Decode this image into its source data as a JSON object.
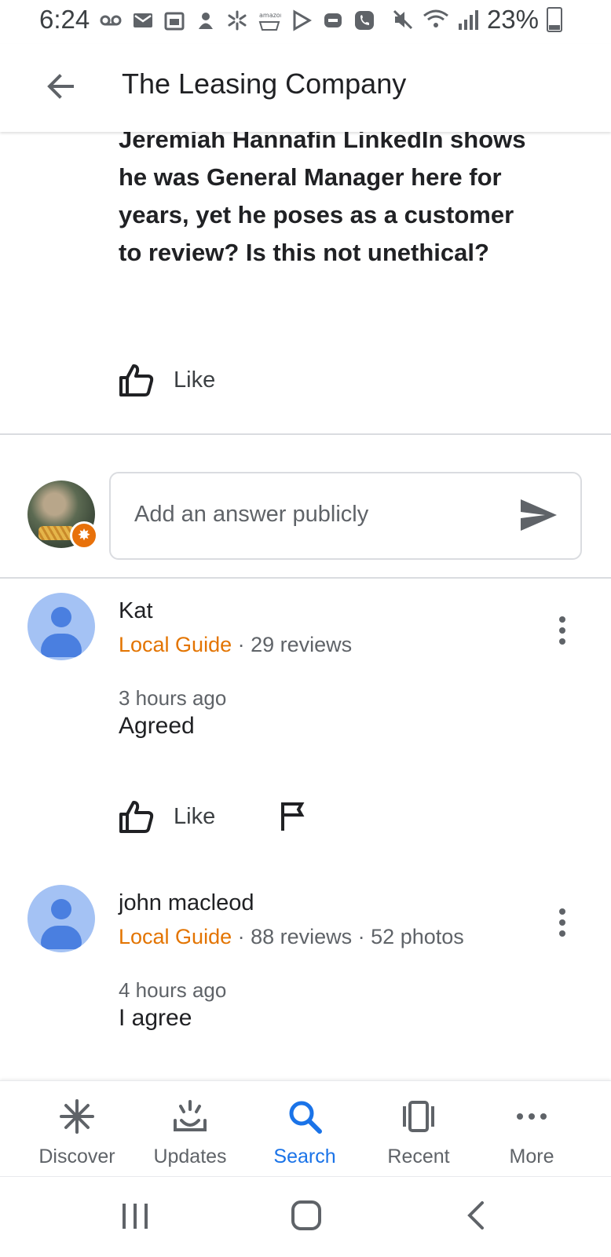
{
  "status_bar": {
    "time": "6:24",
    "battery": "23%",
    "notification_icons": [
      "voicemail-icon",
      "gmail-icon",
      "calendar-icon",
      "app-icon",
      "walmart-icon",
      "amazon-icon",
      "play-store-icon",
      "messenger-icon",
      "phone-icon"
    ],
    "right_icons": [
      "mute-icon",
      "wifi-icon",
      "signal-icon",
      "battery-icon"
    ]
  },
  "app_bar": {
    "title": "The Leasing Company"
  },
  "question": {
    "text": "Jeremiah Hannafin LinkedIn shows he was General Manager here for years, yet he poses as a customer to review? Is this not unethical?",
    "like_label": "Like"
  },
  "answer_input": {
    "placeholder": "Add an answer publicly"
  },
  "replies": [
    {
      "name": "Kat",
      "badge": "Local Guide",
      "stats": "· 29 reviews",
      "time": "3 hours ago",
      "text": "Agreed",
      "like_label": "Like"
    },
    {
      "name": "john macleod",
      "badge": "Local Guide",
      "stats": "· 88 reviews · 52 photos",
      "time": "4 hours ago",
      "text": "I agree"
    }
  ],
  "bottom_nav": {
    "items": [
      {
        "label": "Discover",
        "icon": "discover-icon"
      },
      {
        "label": "Updates",
        "icon": "updates-icon"
      },
      {
        "label": "Search",
        "icon": "search-icon",
        "active": true
      },
      {
        "label": "Recent",
        "icon": "recent-icon"
      },
      {
        "label": "More",
        "icon": "more-icon"
      }
    ]
  },
  "colors": {
    "accent": "#1a73e8",
    "local_guide": "#e37400",
    "avatar_bg": "#a4c2f4",
    "avatar_fg": "#4a7fe0"
  }
}
